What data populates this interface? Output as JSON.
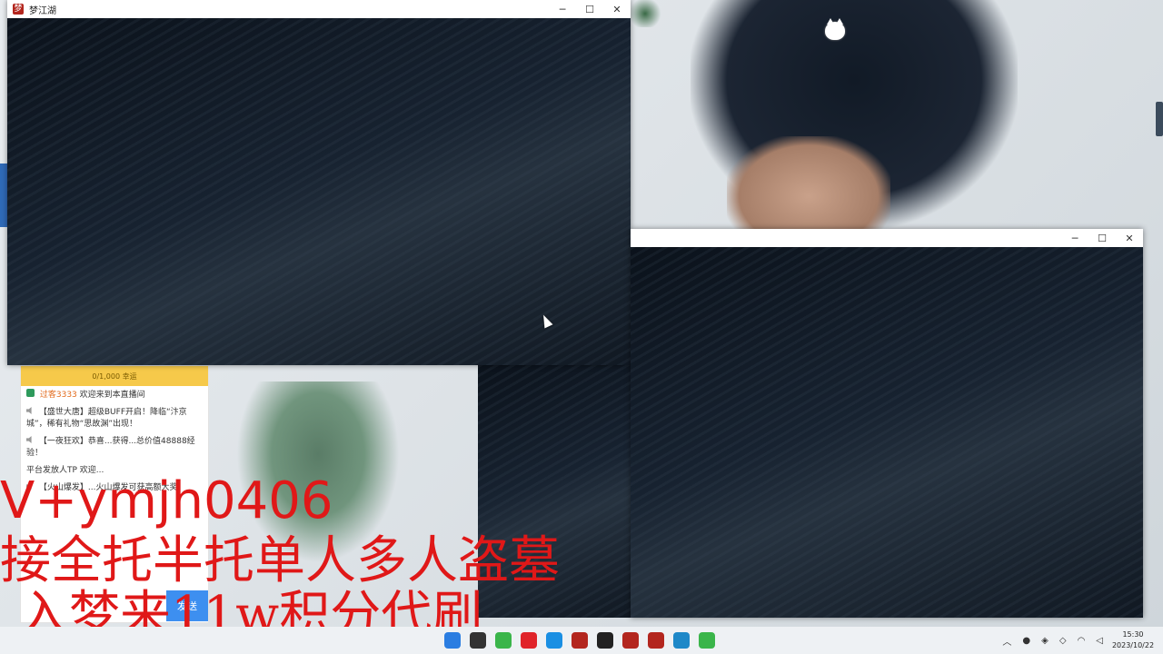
{
  "windows": {
    "main_title": "梦江湖",
    "second_title": "",
    "minimize_symbol": "─",
    "maximize_symbol": "☐",
    "close_symbol": "✕"
  },
  "live_panel": {
    "header": "0/1,000 幸运",
    "messages": [
      {
        "name": "过客3333",
        "text": "欢迎来到本直播间"
      },
      {
        "text": "【盛世大唐】超级BUFF开启！降临“汴京城”，稀有礼物“思故渊”出现！"
      },
      {
        "text": "【一夜狂欢】恭喜...获得...总价值48888经验！"
      },
      {
        "text": "平台发放人TP 欢迎..."
      },
      {
        "text": "【火山爆发】...火山爆发可获高额大奖！"
      }
    ],
    "send_label": "发送"
  },
  "overlay": {
    "line1": "V+ymjh0406",
    "line2": "接全托半托单人多人盗墓",
    "line3": "入梦来11w积分代刷"
  },
  "taskbar": {
    "icons": [
      "windows-start-icon",
      "search-icon",
      "wechat-icon",
      "app-red-icon",
      "kugou-icon",
      "game-icon",
      "steam-icon",
      "game-icon-2",
      "game-icon-3",
      "edge-icon",
      "wechat-icon-2"
    ],
    "time": "15:30",
    "date": "2023/10/22"
  }
}
